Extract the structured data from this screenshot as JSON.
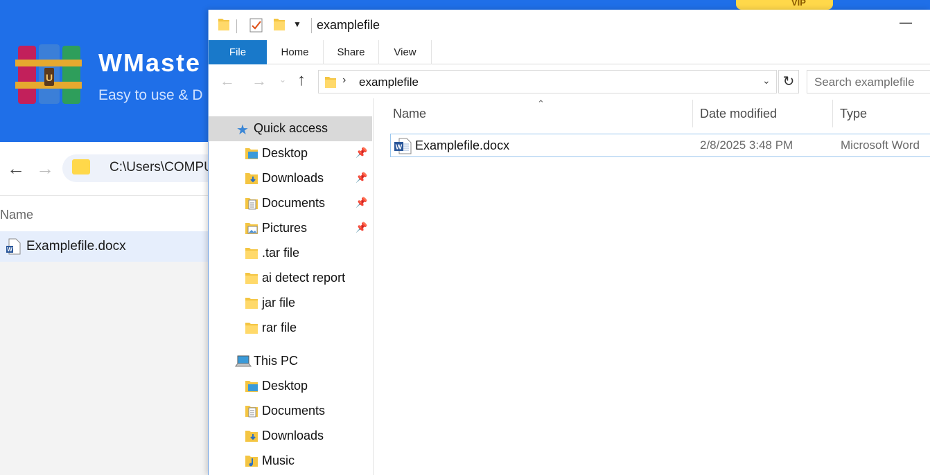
{
  "background_app": {
    "brand": "WMaste",
    "tagline": "Easy to use & D",
    "vip_label": "VIP",
    "path": "C:\\Users\\COMPU",
    "column_name": "Name",
    "file_name": "Examplefile.docx",
    "accent_color": "#1f6fe8"
  },
  "window": {
    "title": "examplefile",
    "ribbon_tabs": [
      "File",
      "Home",
      "Share",
      "View"
    ],
    "address_path": "examplefile",
    "search_placeholder": "Search examplefile",
    "accent_color": "#1979ca"
  },
  "nav_pane": {
    "quick_access": {
      "label": "Quick access",
      "icon": "star-icon",
      "items": [
        {
          "label": "Desktop",
          "icon": "desktop-folder-icon",
          "pinned": true
        },
        {
          "label": "Downloads",
          "icon": "downloads-folder-icon",
          "pinned": true
        },
        {
          "label": "Documents",
          "icon": "documents-folder-icon",
          "pinned": true
        },
        {
          "label": "Pictures",
          "icon": "pictures-folder-icon",
          "pinned": true
        },
        {
          "label": ".tar file",
          "icon": "folder-icon",
          "pinned": false
        },
        {
          "label": "ai detect report",
          "icon": "folder-icon",
          "pinned": false
        },
        {
          "label": "jar file",
          "icon": "folder-icon",
          "pinned": false
        },
        {
          "label": "rar file",
          "icon": "folder-icon",
          "pinned": false
        }
      ]
    },
    "this_pc": {
      "label": "This PC",
      "icon": "computer-icon",
      "items": [
        {
          "label": "Desktop",
          "icon": "desktop-folder-icon"
        },
        {
          "label": "Documents",
          "icon": "documents-folder-icon"
        },
        {
          "label": "Downloads",
          "icon": "downloads-folder-icon"
        },
        {
          "label": "Music",
          "icon": "music-folder-icon"
        }
      ]
    }
  },
  "file_list": {
    "columns": {
      "name": "Name",
      "date_modified": "Date modified",
      "type": "Type"
    },
    "rows": [
      {
        "name": "Examplefile.docx",
        "date_modified": "2/8/2025 3:48 PM",
        "type": "Microsoft Word",
        "icon": "word-document-icon"
      }
    ]
  }
}
